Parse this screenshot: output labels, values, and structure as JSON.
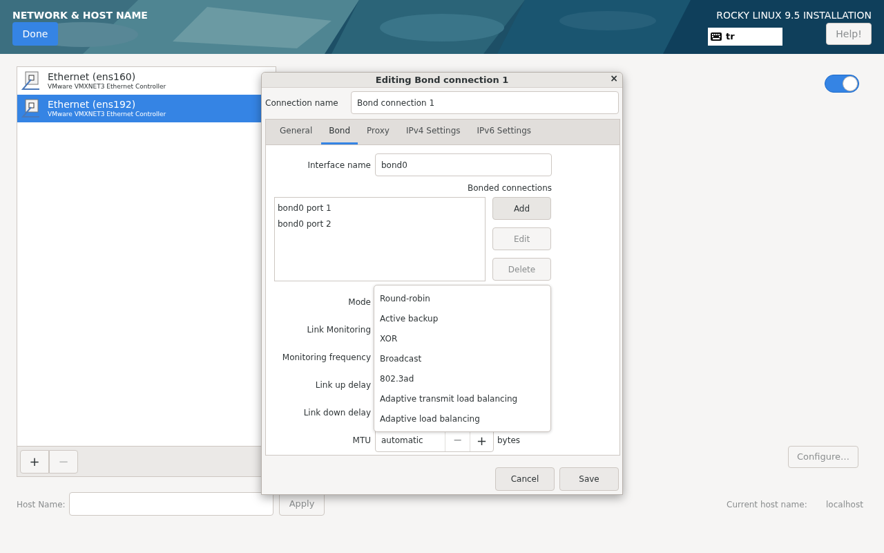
{
  "header": {
    "title": "NETWORK & HOST NAME",
    "done_button": "Done",
    "product": "ROCKY LINUX 9.5 INSTALLATION",
    "keyboard_layout": "tr",
    "help_button": "Help!"
  },
  "devices": [
    {
      "name": "Ethernet (ens160)",
      "description": "VMware VMXNET3 Ethernet Controller",
      "selected": false
    },
    {
      "name": "Ethernet (ens192)",
      "description": "VMware VMXNET3 Ethernet Controller",
      "selected": true
    }
  ],
  "device_buttons": [
    {
      "label": "+",
      "disabled": false
    },
    {
      "label": "−",
      "disabled": true
    }
  ],
  "device_switch": {
    "on": true
  },
  "configure_button": {
    "label": "Configure…",
    "disabled": true
  },
  "host_name": {
    "label": "Host Name:",
    "apply_button": "Apply"
  },
  "current_host_name": {
    "label": "Current host name:",
    "value": "localhost"
  },
  "dialog": {
    "title": "Editing Bond connection 1",
    "close_button": "×",
    "connection_name_label": "Connection name",
    "connection_name": "Bond connection 1",
    "tabs": [
      {
        "label": "General",
        "selected": false
      },
      {
        "label": "Bond",
        "selected": true
      },
      {
        "label": "Proxy",
        "selected": false
      },
      {
        "label": "IPv4 Settings",
        "selected": false
      },
      {
        "label": "IPv6 Settings",
        "selected": false
      }
    ],
    "interface_name_label": "Interface name",
    "interface_name": "bond0",
    "bonded_label": "Bonded connections",
    "bonded_connections": [
      "bond0 port 1",
      "bond0 port 2"
    ],
    "bonded_buttons": [
      {
        "label": "Add",
        "disabled": false
      },
      {
        "label": "Edit",
        "disabled": true
      },
      {
        "label": "Delete",
        "disabled": true
      }
    ],
    "field_labels": [
      "Mode",
      "Link Monitoring",
      "Monitoring frequency",
      "Link up delay",
      "Link down delay",
      "MTU"
    ],
    "mode_options": [
      "Round-robin",
      "Active backup",
      "XOR",
      "Broadcast",
      "802.3ad",
      "Adaptive transmit load balancing",
      "Adaptive load balancing"
    ],
    "mtu": {
      "value": "automatic",
      "decrement": "−",
      "decrement_disabled": true,
      "increment": "+",
      "unit": "bytes"
    },
    "buttons": [
      "Cancel",
      "Save"
    ]
  }
}
